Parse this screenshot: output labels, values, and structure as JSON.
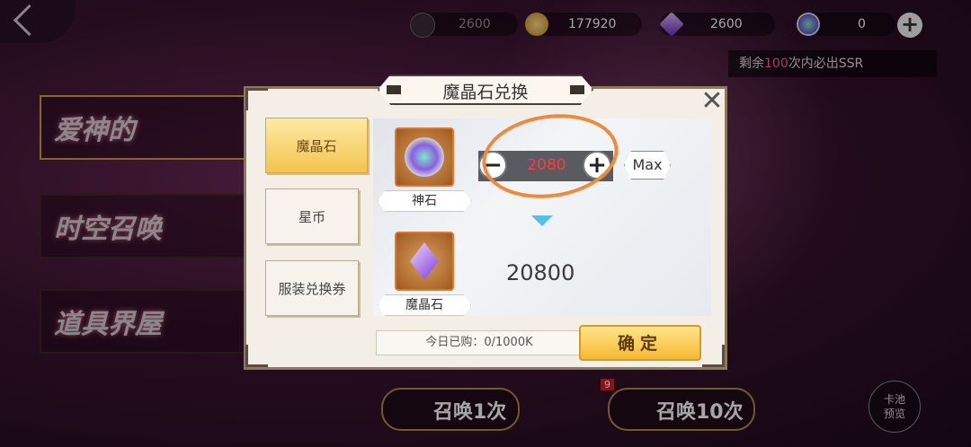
{
  "topbar": {
    "res1_value": "2600",
    "res2_value": "177920",
    "res3_value": "2600",
    "res4_value": "0",
    "add_symbol": "+"
  },
  "banner": {
    "prefix": "剩余",
    "count": "100",
    "suffix": "次内必出SSR"
  },
  "side_menu": [
    {
      "label": "爱神的"
    },
    {
      "label": "时空召唤"
    },
    {
      "label": "道具界屋"
    }
  ],
  "bottom": {
    "summon1_label": "召唤1次",
    "summon10_label": "召唤10次",
    "badge": "9",
    "pool_label_1": "卡池",
    "pool_label_2": "预览"
  },
  "modal": {
    "title": "魔晶石兑换",
    "close_symbol": "✕",
    "tabs": [
      {
        "label": "魔晶石"
      },
      {
        "label": "星币"
      },
      {
        "label": "服装兑换券"
      }
    ],
    "source_item": "神石",
    "target_item": "魔晶石",
    "quantity": "2080",
    "minus_symbol": "−",
    "plus_symbol": "+",
    "max_label": "Max",
    "result_value": "20800",
    "daily_limit": "今日已购：0/1000K",
    "confirm_label": "确定"
  },
  "colors": {
    "accent": "#f5b930",
    "annotation": "#f08a3a",
    "quantity_text": "#ff3b3b"
  }
}
